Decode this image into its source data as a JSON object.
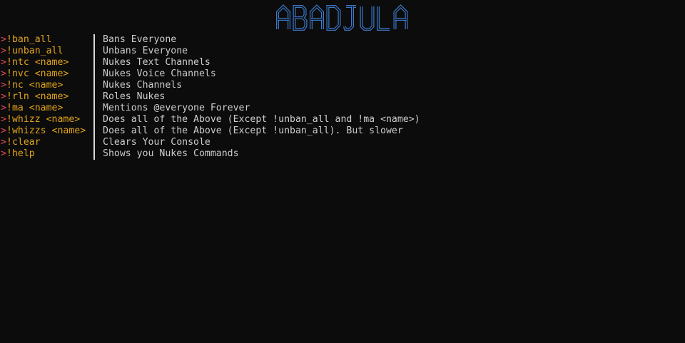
{
  "banner": {
    "text": "ABADJULA",
    "color": "#3b78c8"
  },
  "colors": {
    "background": "#0c0c0c",
    "prompt": "#e74856",
    "command": "#e1a41a",
    "description": "#cccccc",
    "divider": "#d9d9d9"
  },
  "prompt_symbol": ">",
  "commands": [
    {
      "command": "!ban_all",
      "description": "Bans Everyone"
    },
    {
      "command": "!unban_all",
      "description": "Unbans Everyone"
    },
    {
      "command": "!ntc <name>",
      "description": "Nukes Text Channels"
    },
    {
      "command": "!nvc <name>",
      "description": "Nukes Voice Channels"
    },
    {
      "command": "!nc <name>",
      "description": "Nukes Channels"
    },
    {
      "command": "!rln <name>",
      "description": "Roles Nukes"
    },
    {
      "command": "!ma <name>",
      "description": "Mentions @everyone Forever"
    },
    {
      "command": "!whizz <name>",
      "description": "Does all of the Above (Except !unban_all and !ma <name>)"
    },
    {
      "command": "!whizzs <name>",
      "description": "Does all of the Above (Except !unban_all). But slower"
    },
    {
      "command": "!clear",
      "description": "Clears Your Console"
    },
    {
      "command": "!help",
      "description": "Shows you Nukes Commands"
    }
  ]
}
